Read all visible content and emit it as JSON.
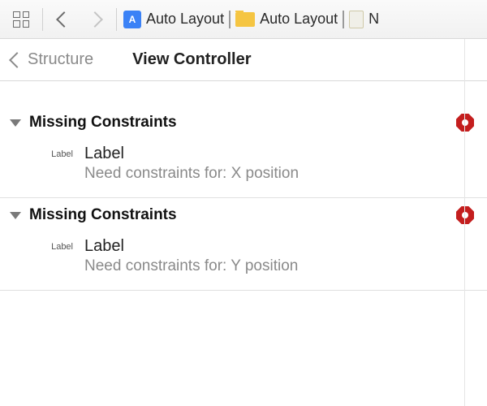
{
  "toolbar": {
    "breadcrumb": {
      "project": "Auto Layout",
      "folder": "Auto Layout",
      "file_initial": "N"
    }
  },
  "header": {
    "back_label": "Structure",
    "title": "View Controller"
  },
  "sections": [
    {
      "title": "Missing Constraints",
      "thumb_label": "Label",
      "element_name": "Label",
      "detail": "Need constraints for: X position"
    },
    {
      "title": "Missing Constraints",
      "thumb_label": "Label",
      "element_name": "Label",
      "detail": "Need constraints for: Y position"
    }
  ]
}
